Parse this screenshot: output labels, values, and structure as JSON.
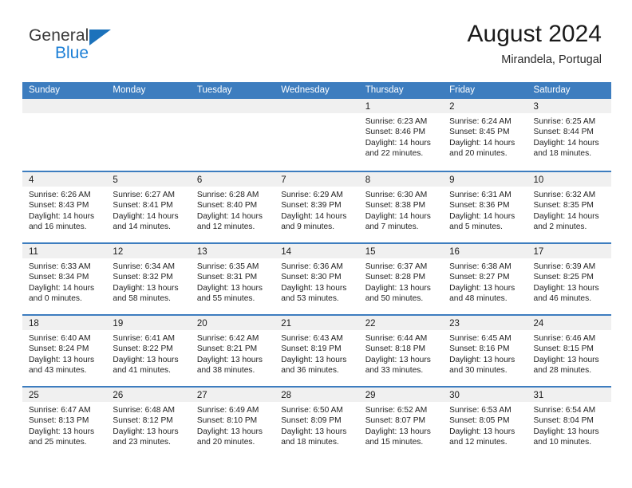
{
  "brand": {
    "name_top": "General",
    "name_bottom": "Blue",
    "accent_color": "#1c7fd6",
    "triangle_color": "#1c72bb"
  },
  "header": {
    "title": "August 2024",
    "subtitle": "Mirandela, Portugal"
  },
  "theme": {
    "header_row_bg": "#3d7dbf",
    "row_divider": "#3d7dbf",
    "day_number_band_bg": "#f0f0f0",
    "text_color": "#1f1f1f"
  },
  "weekdays": [
    "Sunday",
    "Monday",
    "Tuesday",
    "Wednesday",
    "Thursday",
    "Friday",
    "Saturday"
  ],
  "weeks": [
    [
      {
        "day": "",
        "lines": []
      },
      {
        "day": "",
        "lines": []
      },
      {
        "day": "",
        "lines": []
      },
      {
        "day": "",
        "lines": []
      },
      {
        "day": "1",
        "lines": [
          "Sunrise: 6:23 AM",
          "Sunset: 8:46 PM",
          "Daylight: 14 hours",
          "and 22 minutes."
        ]
      },
      {
        "day": "2",
        "lines": [
          "Sunrise: 6:24 AM",
          "Sunset: 8:45 PM",
          "Daylight: 14 hours",
          "and 20 minutes."
        ]
      },
      {
        "day": "3",
        "lines": [
          "Sunrise: 6:25 AM",
          "Sunset: 8:44 PM",
          "Daylight: 14 hours",
          "and 18 minutes."
        ]
      }
    ],
    [
      {
        "day": "4",
        "lines": [
          "Sunrise: 6:26 AM",
          "Sunset: 8:43 PM",
          "Daylight: 14 hours",
          "and 16 minutes."
        ]
      },
      {
        "day": "5",
        "lines": [
          "Sunrise: 6:27 AM",
          "Sunset: 8:41 PM",
          "Daylight: 14 hours",
          "and 14 minutes."
        ]
      },
      {
        "day": "6",
        "lines": [
          "Sunrise: 6:28 AM",
          "Sunset: 8:40 PM",
          "Daylight: 14 hours",
          "and 12 minutes."
        ]
      },
      {
        "day": "7",
        "lines": [
          "Sunrise: 6:29 AM",
          "Sunset: 8:39 PM",
          "Daylight: 14 hours",
          "and 9 minutes."
        ]
      },
      {
        "day": "8",
        "lines": [
          "Sunrise: 6:30 AM",
          "Sunset: 8:38 PM",
          "Daylight: 14 hours",
          "and 7 minutes."
        ]
      },
      {
        "day": "9",
        "lines": [
          "Sunrise: 6:31 AM",
          "Sunset: 8:36 PM",
          "Daylight: 14 hours",
          "and 5 minutes."
        ]
      },
      {
        "day": "10",
        "lines": [
          "Sunrise: 6:32 AM",
          "Sunset: 8:35 PM",
          "Daylight: 14 hours",
          "and 2 minutes."
        ]
      }
    ],
    [
      {
        "day": "11",
        "lines": [
          "Sunrise: 6:33 AM",
          "Sunset: 8:34 PM",
          "Daylight: 14 hours",
          "and 0 minutes."
        ]
      },
      {
        "day": "12",
        "lines": [
          "Sunrise: 6:34 AM",
          "Sunset: 8:32 PM",
          "Daylight: 13 hours",
          "and 58 minutes."
        ]
      },
      {
        "day": "13",
        "lines": [
          "Sunrise: 6:35 AM",
          "Sunset: 8:31 PM",
          "Daylight: 13 hours",
          "and 55 minutes."
        ]
      },
      {
        "day": "14",
        "lines": [
          "Sunrise: 6:36 AM",
          "Sunset: 8:30 PM",
          "Daylight: 13 hours",
          "and 53 minutes."
        ]
      },
      {
        "day": "15",
        "lines": [
          "Sunrise: 6:37 AM",
          "Sunset: 8:28 PM",
          "Daylight: 13 hours",
          "and 50 minutes."
        ]
      },
      {
        "day": "16",
        "lines": [
          "Sunrise: 6:38 AM",
          "Sunset: 8:27 PM",
          "Daylight: 13 hours",
          "and 48 minutes."
        ]
      },
      {
        "day": "17",
        "lines": [
          "Sunrise: 6:39 AM",
          "Sunset: 8:25 PM",
          "Daylight: 13 hours",
          "and 46 minutes."
        ]
      }
    ],
    [
      {
        "day": "18",
        "lines": [
          "Sunrise: 6:40 AM",
          "Sunset: 8:24 PM",
          "Daylight: 13 hours",
          "and 43 minutes."
        ]
      },
      {
        "day": "19",
        "lines": [
          "Sunrise: 6:41 AM",
          "Sunset: 8:22 PM",
          "Daylight: 13 hours",
          "and 41 minutes."
        ]
      },
      {
        "day": "20",
        "lines": [
          "Sunrise: 6:42 AM",
          "Sunset: 8:21 PM",
          "Daylight: 13 hours",
          "and 38 minutes."
        ]
      },
      {
        "day": "21",
        "lines": [
          "Sunrise: 6:43 AM",
          "Sunset: 8:19 PM",
          "Daylight: 13 hours",
          "and 36 minutes."
        ]
      },
      {
        "day": "22",
        "lines": [
          "Sunrise: 6:44 AM",
          "Sunset: 8:18 PM",
          "Daylight: 13 hours",
          "and 33 minutes."
        ]
      },
      {
        "day": "23",
        "lines": [
          "Sunrise: 6:45 AM",
          "Sunset: 8:16 PM",
          "Daylight: 13 hours",
          "and 30 minutes."
        ]
      },
      {
        "day": "24",
        "lines": [
          "Sunrise: 6:46 AM",
          "Sunset: 8:15 PM",
          "Daylight: 13 hours",
          "and 28 minutes."
        ]
      }
    ],
    [
      {
        "day": "25",
        "lines": [
          "Sunrise: 6:47 AM",
          "Sunset: 8:13 PM",
          "Daylight: 13 hours",
          "and 25 minutes."
        ]
      },
      {
        "day": "26",
        "lines": [
          "Sunrise: 6:48 AM",
          "Sunset: 8:12 PM",
          "Daylight: 13 hours",
          "and 23 minutes."
        ]
      },
      {
        "day": "27",
        "lines": [
          "Sunrise: 6:49 AM",
          "Sunset: 8:10 PM",
          "Daylight: 13 hours",
          "and 20 minutes."
        ]
      },
      {
        "day": "28",
        "lines": [
          "Sunrise: 6:50 AM",
          "Sunset: 8:09 PM",
          "Daylight: 13 hours",
          "and 18 minutes."
        ]
      },
      {
        "day": "29",
        "lines": [
          "Sunrise: 6:52 AM",
          "Sunset: 8:07 PM",
          "Daylight: 13 hours",
          "and 15 minutes."
        ]
      },
      {
        "day": "30",
        "lines": [
          "Sunrise: 6:53 AM",
          "Sunset: 8:05 PM",
          "Daylight: 13 hours",
          "and 12 minutes."
        ]
      },
      {
        "day": "31",
        "lines": [
          "Sunrise: 6:54 AM",
          "Sunset: 8:04 PM",
          "Daylight: 13 hours",
          "and 10 minutes."
        ]
      }
    ]
  ]
}
